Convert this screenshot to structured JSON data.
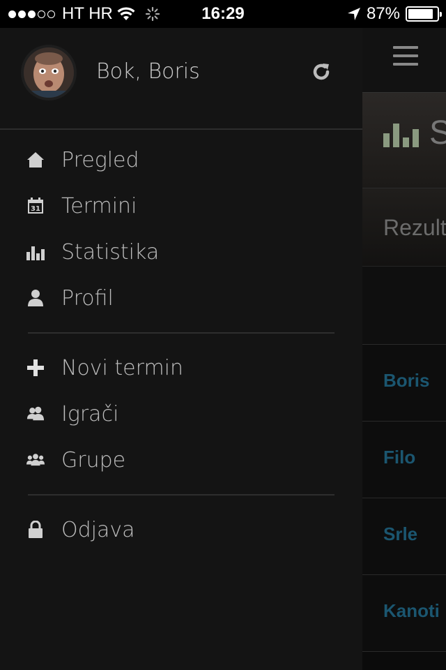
{
  "status_bar": {
    "carrier": "HT HR",
    "time": "16:29",
    "battery": "87%",
    "battery_level": 0.87,
    "signal_bars_filled": 3,
    "signal_bars_total": 5
  },
  "drawer": {
    "greeting": "Bok, Boris",
    "refresh_icon": "refresh-icon",
    "groups": [
      [
        {
          "label": "Pregled",
          "icon": "home-icon"
        },
        {
          "label": "Termini",
          "icon": "calendar-icon"
        },
        {
          "label": "Statistika",
          "icon": "bar-chart-icon"
        },
        {
          "label": "Profil",
          "icon": "user-icon"
        }
      ],
      [
        {
          "label": "Novi termin",
          "icon": "plus-icon"
        },
        {
          "label": "Igrači",
          "icon": "users-icon"
        },
        {
          "label": "Grupe",
          "icon": "group-icon"
        }
      ],
      [
        {
          "label": "Odjava",
          "icon": "lock-icon"
        }
      ]
    ]
  },
  "main": {
    "section_title_partial": "S",
    "results_label_partial": "Rezult",
    "players": [
      "Boris",
      "Filo",
      "Srle",
      "Kanoti"
    ]
  },
  "colors": {
    "drawer_bg": "#141414",
    "player_name": "#1b5670",
    "stat_icon": "#8a9a80"
  }
}
